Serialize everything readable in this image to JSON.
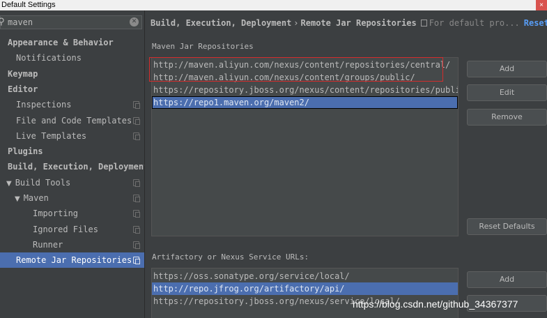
{
  "window": {
    "title": "Default Settings",
    "close_glyph": "×"
  },
  "search": {
    "value": "maven",
    "clear_glyph": "✕",
    "icon": "search-icon"
  },
  "sidebar": {
    "items": [
      {
        "label": "Appearance & Behavior",
        "indent": 0,
        "bold": true,
        "arrow": ""
      },
      {
        "label": "Notifications",
        "indent": 1,
        "bold": false,
        "arrow": ""
      },
      {
        "label": "Keymap",
        "indent": 0,
        "bold": true,
        "arrow": ""
      },
      {
        "label": "Editor",
        "indent": 0,
        "bold": true,
        "arrow": ""
      },
      {
        "label": "Inspections",
        "indent": 1,
        "bold": false,
        "arrow": "",
        "copy": true
      },
      {
        "label": "File and Code Templates",
        "indent": 1,
        "bold": false,
        "arrow": "",
        "copy": true
      },
      {
        "label": "Live Templates",
        "indent": 1,
        "bold": false,
        "arrow": "",
        "copy": true
      },
      {
        "label": "Plugins",
        "indent": 0,
        "bold": true,
        "arrow": ""
      },
      {
        "label": "Build, Execution, Deployment",
        "indent": 0,
        "bold": true,
        "arrow": ""
      },
      {
        "label": "Build Tools",
        "indent": 1,
        "bold": false,
        "arrow": "▼",
        "copy": true
      },
      {
        "label": "Maven",
        "indent": 2,
        "bold": false,
        "arrow": "▼",
        "copy": true
      },
      {
        "label": "Importing",
        "indent": 3,
        "bold": false,
        "arrow": "",
        "copy": true
      },
      {
        "label": "Ignored Files",
        "indent": 3,
        "bold": false,
        "arrow": "",
        "copy": true
      },
      {
        "label": "Runner",
        "indent": 3,
        "bold": false,
        "arrow": "",
        "copy": true
      },
      {
        "label": "Remote Jar Repositories",
        "indent": 1,
        "bold": false,
        "arrow": "",
        "copy": true,
        "selected": true
      }
    ]
  },
  "breadcrumb": {
    "parent": "Build, Execution, Deployment",
    "separator": "›",
    "current": "Remote Jar Repositories",
    "scope": "For default pro...",
    "reset": "Reset"
  },
  "maven_section": {
    "label": "Maven Jar Repositories",
    "rows": [
      "http://maven.aliyun.com/nexus/content/repositories/central/",
      "http://maven.aliyun.com/nexus/content/groups/public/",
      "https://repository.jboss.org/nexus/content/repositories/public/",
      "https://repo1.maven.org/maven2/"
    ],
    "selected_index": 3,
    "buttons": {
      "add": "Add",
      "edit": "Edit",
      "remove": "Remove",
      "reset_defaults": "Reset Defaults"
    }
  },
  "artifactory_section": {
    "label": "Artifactory or Nexus Service URLs:",
    "rows": [
      "https://oss.sonatype.org/service/local/",
      "http://repo.jfrog.org/artifactory/api/",
      "https://repository.jboss.org/nexus/service/local/"
    ],
    "selected_index": 1,
    "buttons": {
      "add": "Add"
    }
  },
  "watermark": "https://blog.csdn.net/github_34367377",
  "colors": {
    "background": "#3c3f41",
    "selection": "#4b6eaf",
    "link": "#589df6",
    "highlight_box": "#d52c2c"
  }
}
